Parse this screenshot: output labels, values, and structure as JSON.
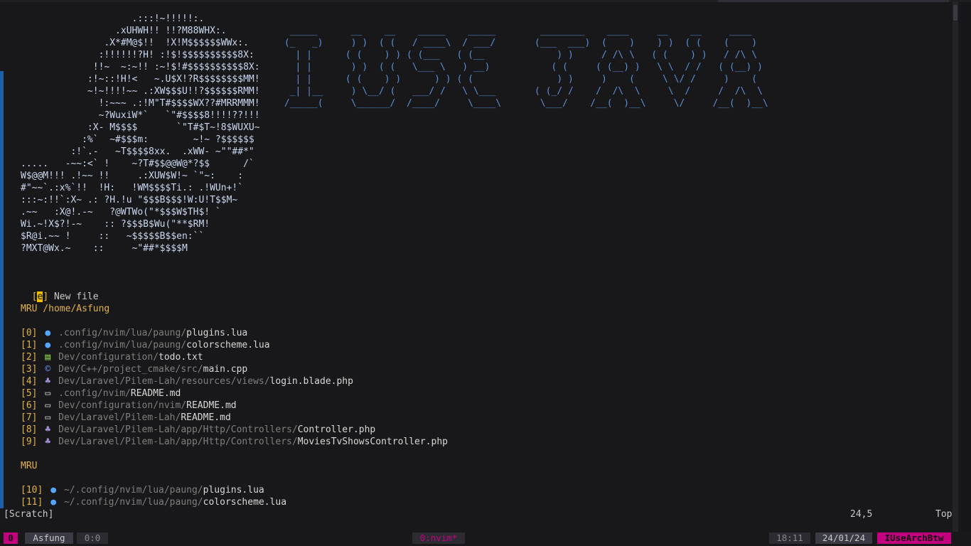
{
  "ascii_art": [
    "                    .:::!~!!!!!:.",
    "                 .xUHWH!! !!?M88WHX:.",
    "               .X*#M@$!!  !X!M$$$$$$WWx:.",
    "              :!!!!!!?H! :!$!$$$$$$$$$$8X:",
    "             !!~  ~:~!! :~!$!#$$$$$$$$$$8X:",
    "            :!~::!H!<   ~.U$X!?R$$$$$$$$MM!",
    "            ~!~!!!!~~ .:XW$$$U!!?$$$$$$RMM!",
    "              !:~~~ .:!M\"T#$$$$WX??#MRRMMM!",
    "              ~?WuxiW*`   `\"#$$$$8!!!!??!!!",
    "            :X- M$$$$       `\"T#$T~!8$WUXU~",
    "           :%`  ~#$$$m:        ~!~ ?$$$$$$",
    "         :!`.-   ~T$$$$8xx.  .xWW- ~\"\"##*\"",
    ".....   -~~:<` !    ~?T#$$@@W@*?$$      /`",
    "W$@@M!!! .!~~ !!     .:XUW$W!~ `\"~:    :",
    "#\"~~`.:x%`!!  !H:   !WM$$$$Ti.: .!WUn+!`",
    ":::~:!!`:X~ .: ?H.!u \"$$$B$$$!W:U!T$$M~",
    ".~~   :X@!.-~   ?@WTWo(\"*$$$W$TH$! `",
    "Wi.~!X$?!-~    :: ?$$$B$Wu(\"**$RM!",
    "$R@i.~~ !     ::   ~$$$$$B$$en:``",
    "?MXT@Wx.~    ::     ~\"##*$$$$M"
  ],
  "banner": [
    "  _____      __    __    _____    _____        ________    ____     __    __     ____  ",
    " (_   _)     ) )  ( (   / ____\\  / ___/       (___  ___)  (    )    ) )  ( (    (    ) ",
    "   | |      ( (    ) ) ( (___   ( (__             ) )     / /\\ \\   ( (    ) )   / /\\ \\ ",
    "   | |       ) )  ( (   \\___ \\   ) __)           ( (     ( (__) )   \\ \\  / /   ( (__) )",
    "   | |      ( (    ) )      ) ) ( (               ) )     )    (     \\ \\/ /     )    ( ",
    "  _| |__     ) \\__/ (   ___/ /   \\ \\___       ( (_/ /    /  /\\  \\     \\  /     /  /\\  \\",
    " /_____(     \\______/  /____/     \\____\\       \\___/    /__(  )__\\     \\/     /__(  )__\\"
  ],
  "new_file": {
    "open": "[",
    "key": "e",
    "close": "]",
    "label": "New file"
  },
  "mru_cwd": {
    "header": "MRU /home/Asfung"
  },
  "mru_cwd_items": [
    {
      "index": "[0]",
      "icon": "lua",
      "dir": ".config/nvim/lua/paung/",
      "file": "plugins.lua"
    },
    {
      "index": "[1]",
      "icon": "lua",
      "dir": ".config/nvim/lua/paung/",
      "file": "colorscheme.lua"
    },
    {
      "index": "[2]",
      "icon": "txt",
      "dir": "Dev/configuration/",
      "file": "todo.txt"
    },
    {
      "index": "[3]",
      "icon": "cpp",
      "dir": "Dev/C++/project_cmake/src/",
      "file": "main.cpp"
    },
    {
      "index": "[4]",
      "icon": "php",
      "dir": "Dev/Laravel/Pilem-Lah/resources/views/",
      "file": "login.blade.php"
    },
    {
      "index": "[5]",
      "icon": "md",
      "dir": ".config/nvim/",
      "file": "README.md"
    },
    {
      "index": "[6]",
      "icon": "md",
      "dir": "Dev/configuration/nvim/",
      "file": "README.md"
    },
    {
      "index": "[7]",
      "icon": "md",
      "dir": "Dev/Laravel/Pilem-Lah/",
      "file": "README.md"
    },
    {
      "index": "[8]",
      "icon": "php",
      "dir": "Dev/Laravel/Pilem-Lah/app/Http/Controllers/",
      "file": "Controller.php"
    },
    {
      "index": "[9]",
      "icon": "php",
      "dir": "Dev/Laravel/Pilem-Lah/app/Http/Controllers/",
      "file": "MoviesTvShowsController.php"
    }
  ],
  "mru_global": {
    "header": "MRU"
  },
  "mru_global_items": [
    {
      "index": "[10]",
      "icon": "lua",
      "dir": "~/.config/nvim/lua/paung/",
      "file": "plugins.lua"
    },
    {
      "index": "[11]",
      "icon": "lua",
      "dir": "~/.config/nvim/lua/paung/",
      "file": "colorscheme.lua"
    }
  ],
  "icons": {
    "lua": "●",
    "txt": "▤",
    "cpp": "©",
    "php": "♣",
    "md": "▭"
  },
  "statusline": {
    "buffer": "[Scratch]",
    "position": "24,5",
    "scroll": "Top"
  },
  "tmux": {
    "session": "0",
    "user": "Asfung",
    "panes": "0:0",
    "window": "0:nvim*",
    "time": "18:11",
    "date": "24/01/24",
    "host": "IUseArchBtw"
  }
}
